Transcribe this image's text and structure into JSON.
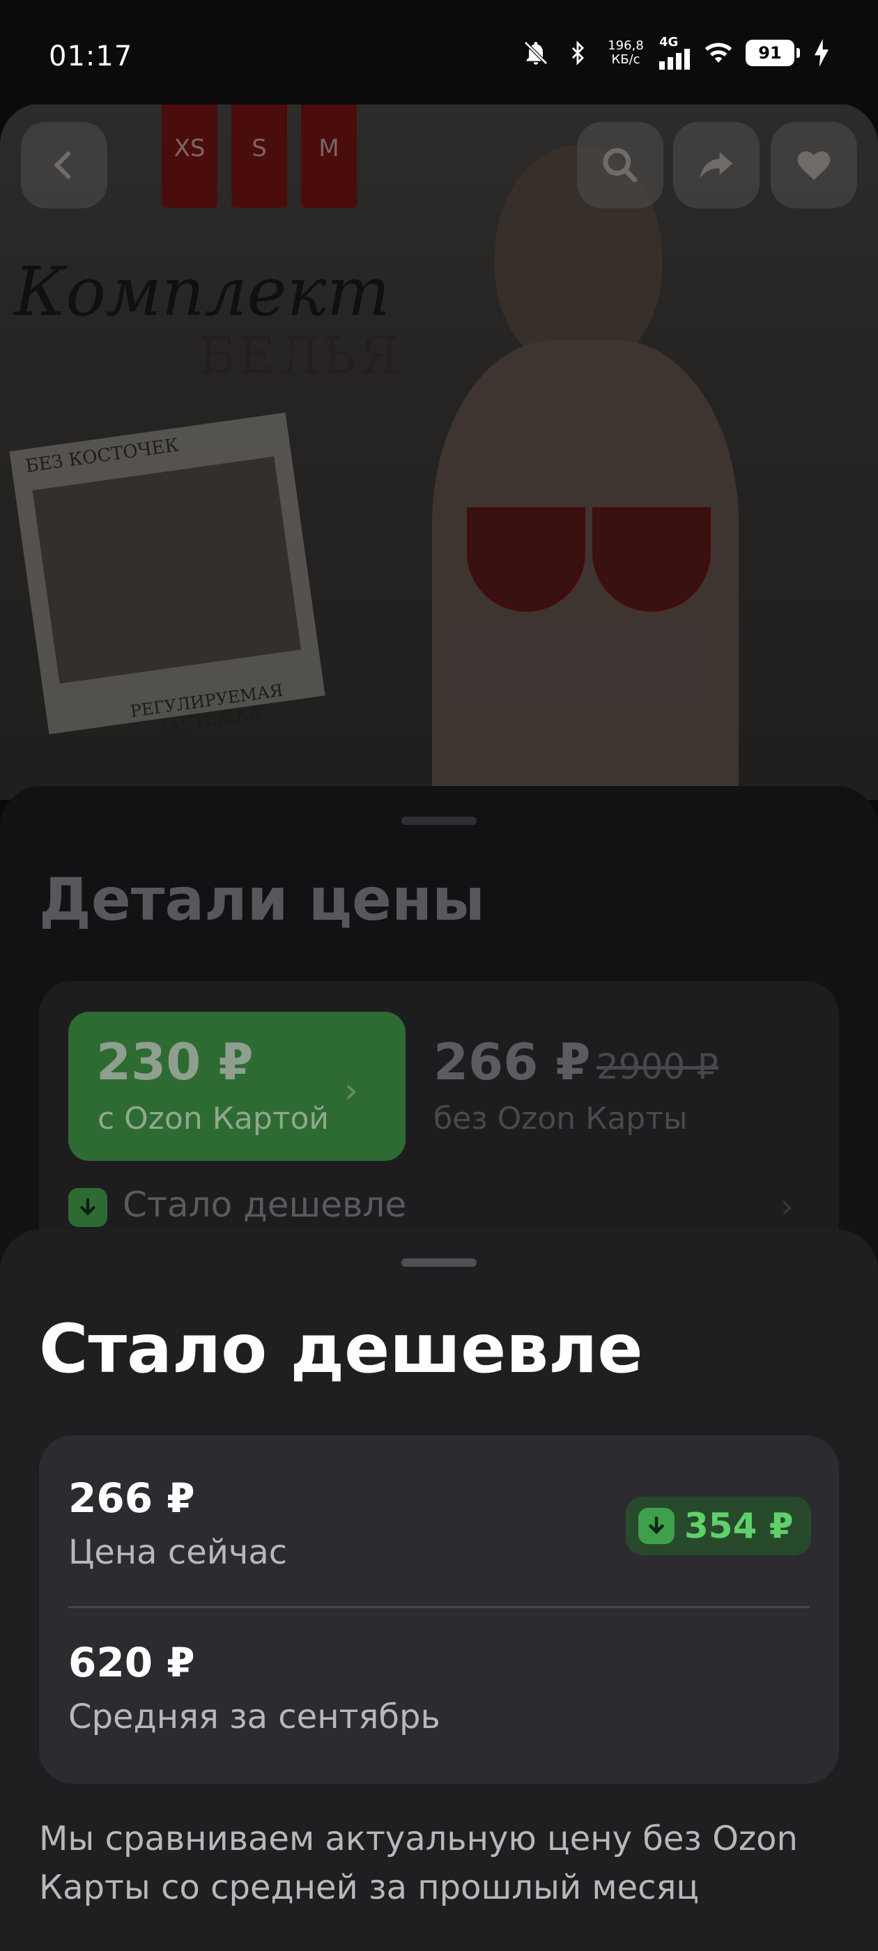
{
  "status_bar": {
    "time": "01:17",
    "net_speed_value": "196,8",
    "net_speed_unit": "КБ/с",
    "network_type": "4G",
    "battery": "91"
  },
  "product_image": {
    "sizes": [
      "XS",
      "S",
      "M"
    ],
    "script_title": "Комплект",
    "subtitle": "БЕЛЬЯ",
    "caption_top": "БЕЗ КОСТОЧЕК",
    "caption_bottom_1": "РЕГУЛИРУЕМАЯ",
    "caption_bottom_2": "ЗАСТЕЖКА"
  },
  "price_sheet": {
    "title": "Детали цены",
    "card_price": "230 ₽",
    "card_label": "с Ozon Картой",
    "regular_price": "266 ₽",
    "old_price": "2900 ₽",
    "regular_label": "без Ozon Карты",
    "cheaper_row": "Стало дешевле"
  },
  "bottom_sheet": {
    "title": "Стало дешевле",
    "current_price": "266 ₽",
    "current_label": "Цена сейчас",
    "drop_amount": "354 ₽",
    "avg_price": "620 ₽",
    "avg_label": "Средняя за сентябрь",
    "footnote": "Мы сравниваем актуальную цену без Ozon Карты со средней за прошлый месяц"
  },
  "colors": {
    "accent_green": "#5fd16b",
    "card_green": "#2e6b32",
    "sheet_bg": "#1f1f22"
  }
}
